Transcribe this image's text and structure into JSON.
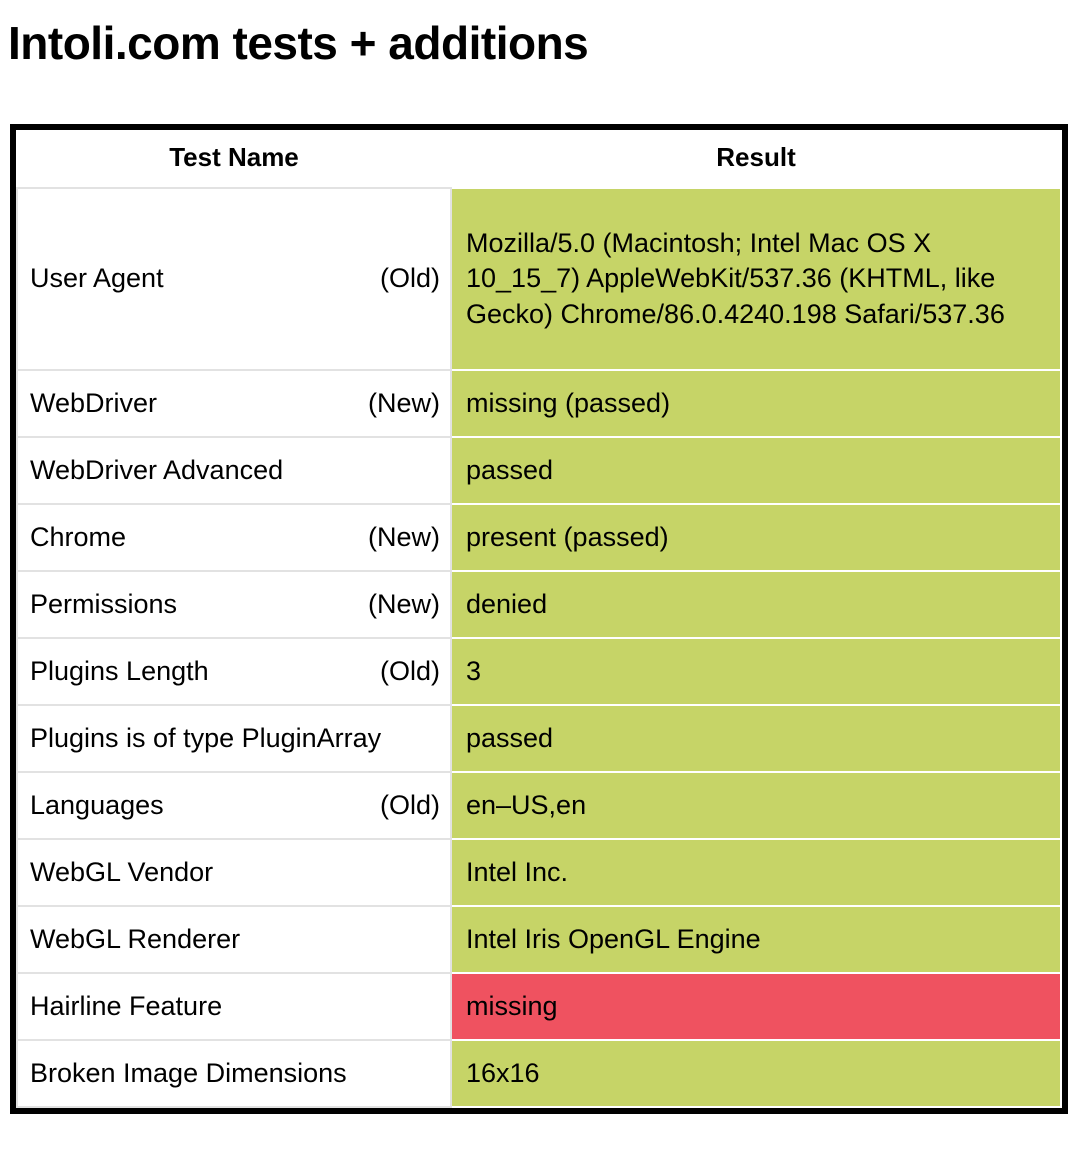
{
  "page": {
    "title": "Intoli.com tests + additions"
  },
  "colors": {
    "pass_background": "#c6d467",
    "fail_background": "#ef5260",
    "frame_border": "#000000",
    "cell_border": "#e2e2e2",
    "text": "#000000"
  },
  "table": {
    "columns": [
      {
        "key": "test_name",
        "label": "Test Name"
      },
      {
        "key": "result",
        "label": "Result"
      }
    ],
    "rows": [
      {
        "test_name": "User Agent",
        "age_tag": "(Old)",
        "result": "Mozilla/5.0 (Macintosh; Intel Mac OS X 10_15_7) AppleWebKit/537.36 (KHTML, like Gecko) Chrome/86.0.4240.198 Safari/537.36",
        "status": "pass"
      },
      {
        "test_name": "WebDriver",
        "age_tag": "(New)",
        "result": "missing (passed)",
        "status": "pass"
      },
      {
        "test_name": "WebDriver Advanced",
        "age_tag": "",
        "result": "passed",
        "status": "pass"
      },
      {
        "test_name": "Chrome",
        "age_tag": "(New)",
        "result": "present (passed)",
        "status": "pass"
      },
      {
        "test_name": "Permissions",
        "age_tag": "(New)",
        "result": "denied",
        "status": "pass"
      },
      {
        "test_name": "Plugins Length",
        "age_tag": "(Old)",
        "result": "3",
        "status": "pass"
      },
      {
        "test_name": "Plugins is of type PluginArray",
        "age_tag": "",
        "result": "passed",
        "status": "pass"
      },
      {
        "test_name": "Languages",
        "age_tag": "(Old)",
        "result": "en–US,en",
        "status": "pass"
      },
      {
        "test_name": "WebGL Vendor",
        "age_tag": "",
        "result": "Intel Inc.",
        "status": "pass"
      },
      {
        "test_name": "WebGL Renderer",
        "age_tag": "",
        "result": "Intel Iris OpenGL Engine",
        "status": "pass"
      },
      {
        "test_name": "Hairline Feature",
        "age_tag": "",
        "result": "missing",
        "status": "fail"
      },
      {
        "test_name": "Broken Image Dimensions",
        "age_tag": "",
        "result": "16x16",
        "status": "pass"
      }
    ]
  }
}
